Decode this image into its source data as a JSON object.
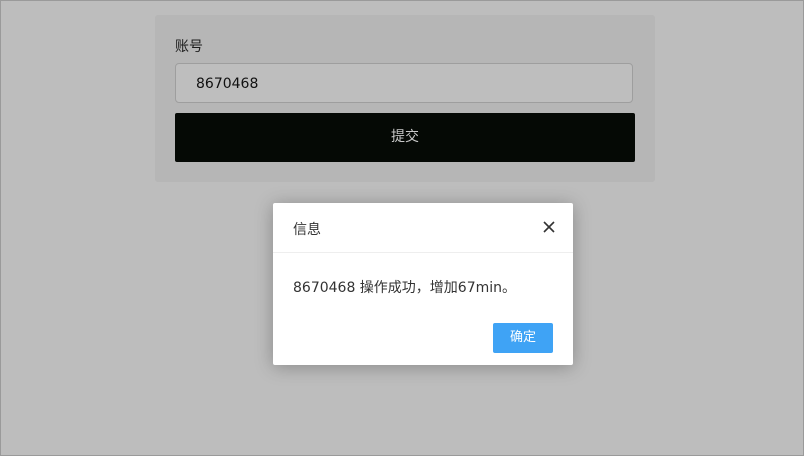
{
  "form": {
    "account_label": "账号",
    "account_value": "8670468",
    "submit_label": "提交"
  },
  "dialog": {
    "title": "信息",
    "message": "8670468 操作成功，增加67min。",
    "confirm_label": "确定",
    "close_icon": "close-icon"
  },
  "colors": {
    "confirm_button": "#3fa3f5",
    "submit_button": "#050905",
    "overlay_background": "#c4c4c4"
  }
}
